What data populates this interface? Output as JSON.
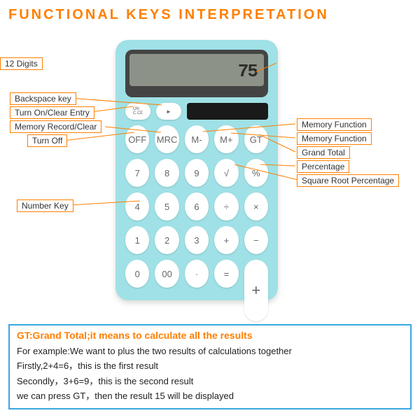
{
  "title": "FUNCTIONAL KEYS INTERPRETATION",
  "display": "75",
  "toprow": {
    "on": "ON\nC.CE",
    "back": "►"
  },
  "keys": {
    "r1": [
      "OFF",
      "MRC",
      "M-",
      "M+",
      "GT"
    ],
    "r2": [
      "7",
      "8",
      "9",
      "√",
      "%"
    ],
    "r3": [
      "4",
      "5",
      "6",
      "÷",
      "×"
    ],
    "r4": [
      "1",
      "2",
      "3",
      "+",
      "−"
    ],
    "r5": [
      "0",
      "00",
      "·",
      "="
    ]
  },
  "labels": {
    "digits": "12 Digits",
    "backspace": "Backspace key",
    "onclear": "Turn On/Clear Entry",
    "mrc": "Memory Record/Clear",
    "off": "Turn Off",
    "numkey": "Number Key",
    "mem1": "Memory Function",
    "mem2": "Memory Function",
    "gt": "Grand Total",
    "pct": "Percentage",
    "sqrt": "Square Root Percentage"
  },
  "info": {
    "title": "GT:Grand Total;it means to calculate all the results",
    "l1": "For example:We want to plus the two  results of calculations together",
    "l2": "Firstly,2+4=6，this is the first result",
    "l3": "Secondly，3+6=9，this is the second result",
    "l4": "we can press GT，then the result 15 will be displayed"
  }
}
